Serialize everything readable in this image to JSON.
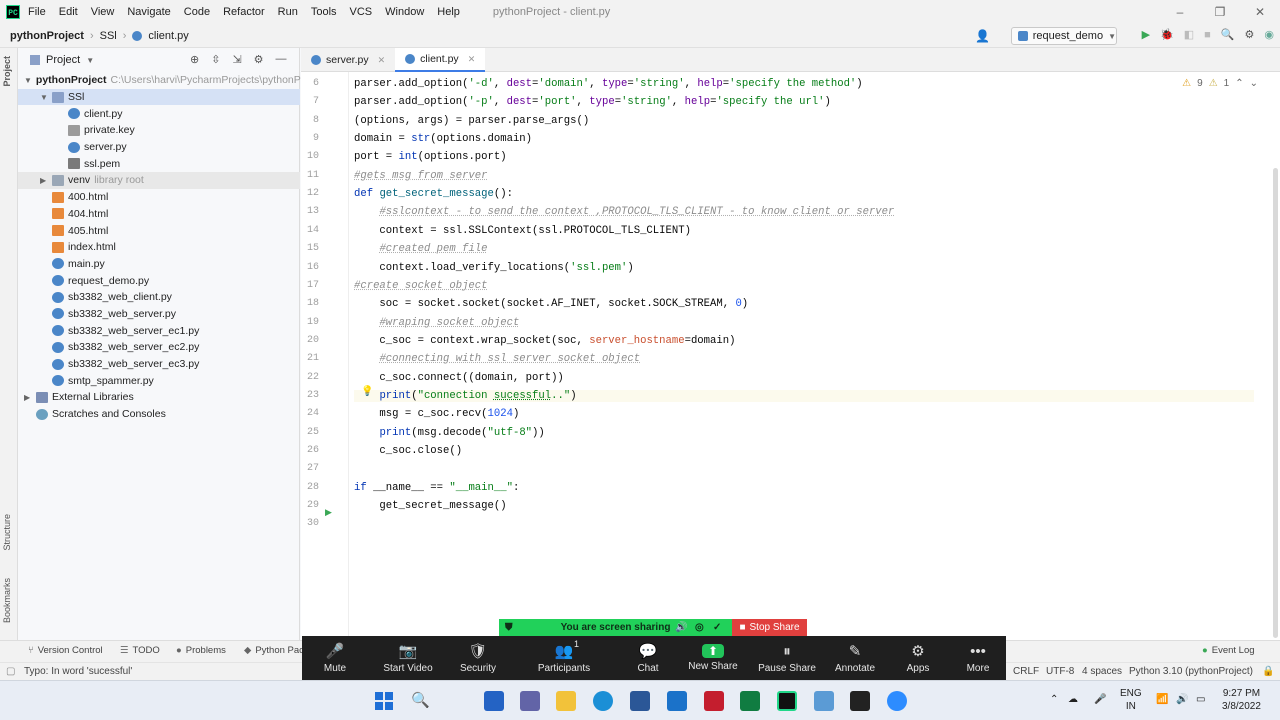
{
  "window": {
    "title": "pythonProject - client.py",
    "menu": [
      "File",
      "Edit",
      "View",
      "Navigate",
      "Code",
      "Refactor",
      "Run",
      "Tools",
      "VCS",
      "Window",
      "Help"
    ],
    "buttons": [
      "–",
      "❐",
      "✕"
    ]
  },
  "nav": {
    "project": "pythonProject",
    "folder": "SSl",
    "file": "client.py",
    "run_config": "request_demo"
  },
  "project_panel": {
    "title": "Project",
    "root": "pythonProject",
    "root_path": "C:\\Users\\harvi\\PycharmProjects\\pythonP",
    "items": [
      {
        "label": "SSl",
        "type": "folder",
        "level": 1
      },
      {
        "label": "client.py",
        "type": "py",
        "level": 2
      },
      {
        "label": "private.key",
        "type": "key",
        "level": 2
      },
      {
        "label": "server.py",
        "type": "py",
        "level": 2
      },
      {
        "label": "ssl.pem",
        "type": "pem",
        "level": 2
      },
      {
        "label": "venv",
        "type": "folder-y",
        "level": 1,
        "extra": "library root"
      },
      {
        "label": "400.html",
        "type": "html",
        "level": 1
      },
      {
        "label": "404.html",
        "type": "html",
        "level": 1
      },
      {
        "label": "405.html",
        "type": "html",
        "level": 1
      },
      {
        "label": "index.html",
        "type": "html",
        "level": 1
      },
      {
        "label": "main.py",
        "type": "py",
        "level": 1
      },
      {
        "label": "request_demo.py",
        "type": "py",
        "level": 1
      },
      {
        "label": "sb3382_web_client.py",
        "type": "py",
        "level": 1
      },
      {
        "label": "sb3382_web_server.py",
        "type": "py",
        "level": 1
      },
      {
        "label": "sb3382_web_server_ec1.py",
        "type": "py",
        "level": 1
      },
      {
        "label": "sb3382_web_server_ec2.py",
        "type": "py",
        "level": 1
      },
      {
        "label": "sb3382_web_server_ec3.py",
        "type": "py",
        "level": 1
      },
      {
        "label": "smtp_spammer.py",
        "type": "py",
        "level": 1
      },
      {
        "label": "External Libraries",
        "type": "lib",
        "level": 0
      },
      {
        "label": "Scratches and Consoles",
        "type": "scr",
        "level": 0
      }
    ]
  },
  "tabs": [
    {
      "label": "server.py",
      "active": false
    },
    {
      "label": "client.py",
      "active": true
    }
  ],
  "inspections": {
    "warnings": "9",
    "weak": "1"
  },
  "code_lines": [
    {
      "n": "6",
      "html": "parser.add_option(<span class='str'>'-d'</span>, <span class='prm'>dest</span>=<span class='str'>'domain'</span>, <span class='prm'>type</span>=<span class='str'>'string'</span>, <span class='prm'>help</span>=<span class='str'>'specify the method'</span>)"
    },
    {
      "n": "7",
      "html": "parser.add_option(<span class='str'>'-p'</span>, <span class='prm'>dest</span>=<span class='str'>'port'</span>, <span class='prm'>type</span>=<span class='str'>'string'</span>, <span class='prm'>help</span>=<span class='str'>'specify the url'</span>)"
    },
    {
      "n": "8",
      "html": "(options, args) = parser.parse_args()"
    },
    {
      "n": "9",
      "html": "domain = <span class='kw'>str</span>(options.domain)"
    },
    {
      "n": "10",
      "html": "port = <span class='kw'>int</span>(options.port)"
    },
    {
      "n": "11",
      "html": "<span class='cm'>#gets msg from server</span>"
    },
    {
      "n": "12",
      "html": "<span class='kw'>def</span> <span class='fn'>get_secret_message</span>():"
    },
    {
      "n": "13",
      "html": "    <span class='cm'>#sslcontext - to send the context ,PROTOCOL_TLS_CLIENT - to know client or server</span>"
    },
    {
      "n": "14",
      "html": "    context = ssl.SSLContext(ssl.PROTOCOL_TLS_CLIENT)"
    },
    {
      "n": "15",
      "html": "    <span class='cm'>#created pem file</span>"
    },
    {
      "n": "16",
      "html": "    context.load_verify_locations(<span class='str'>'ssl.pem'</span>)"
    },
    {
      "n": "17",
      "html": "<span class='cm'>#create socket object</span>"
    },
    {
      "n": "18",
      "html": "    soc = socket.socket(socket.AF_INET, socket.SOCK_STREAM, <span class='num'>0</span>)"
    },
    {
      "n": "19",
      "html": "    <span class='cm'>#wraping socket object</span>"
    },
    {
      "n": "20",
      "html": "    c_soc = context.wrap_socket(soc, <span class='prm' style='color:#c94f2e'>server_hostname</span>=domain)"
    },
    {
      "n": "21",
      "html": "    <span class='cm'>#connecting with ssl server socket object</span>"
    },
    {
      "n": "22",
      "html": "    c_soc.connect((domain, port))"
    },
    {
      "n": "23",
      "html": "    <span class='kw'>print</span>(<span class='str'>\"connection <u style='text-decoration:underline dotted'>sucessful</u>..\"</span>)"
    },
    {
      "n": "24",
      "html": "    msg = c_soc.recv(<span class='num'>1024</span>)"
    },
    {
      "n": "25",
      "html": "    <span class='kw'>print</span>(msg.decode(<span class='str'>\"utf-8\"</span>))"
    },
    {
      "n": "26",
      "html": "    c_soc.close()"
    },
    {
      "n": "27",
      "html": ""
    },
    {
      "n": "28",
      "html": "<span class='kw'>if</span> __name__ == <span class='str'>\"__main__\"</span>:"
    },
    {
      "n": "29",
      "html": "    get_secret_message()"
    },
    {
      "n": "30",
      "html": ""
    }
  ],
  "bottom_tools": [
    "Version Control",
    "TODO",
    "Problems",
    "Python Pac"
  ],
  "event_log": "Event Log",
  "status": {
    "message": "Typo: In word 'sucessful'",
    "line_sep": "CRLF",
    "encoding": "UTF-8",
    "indent": "4 spaces",
    "interpreter": "Python 3.10 (pythonProject)"
  },
  "zoom": {
    "sharing": "You are screen sharing",
    "stop": "Stop Share",
    "buttons": [
      {
        "label": "Mute",
        "g": "🎤"
      },
      {
        "label": "Start Video",
        "g": "📷"
      },
      {
        "label": "Security",
        "g": "🛡"
      },
      {
        "label": "Participants",
        "g": "👥",
        "count": "1"
      },
      {
        "label": "Chat",
        "g": "💬"
      },
      {
        "label": "New Share",
        "g": "⬆"
      },
      {
        "label": "Pause Share",
        "g": "⏸"
      },
      {
        "label": "Annotate",
        "g": "✎"
      },
      {
        "label": "Apps",
        "g": "⚙"
      },
      {
        "label": "More",
        "g": "•••"
      }
    ]
  },
  "taskbar": {
    "lang": "ENG",
    "region": "IN",
    "time": "9:27 PM",
    "date": "3/8/2022"
  },
  "strip_labels": {
    "project": "Project",
    "structure": "Structure",
    "bookmarks": "Bookmarks"
  }
}
